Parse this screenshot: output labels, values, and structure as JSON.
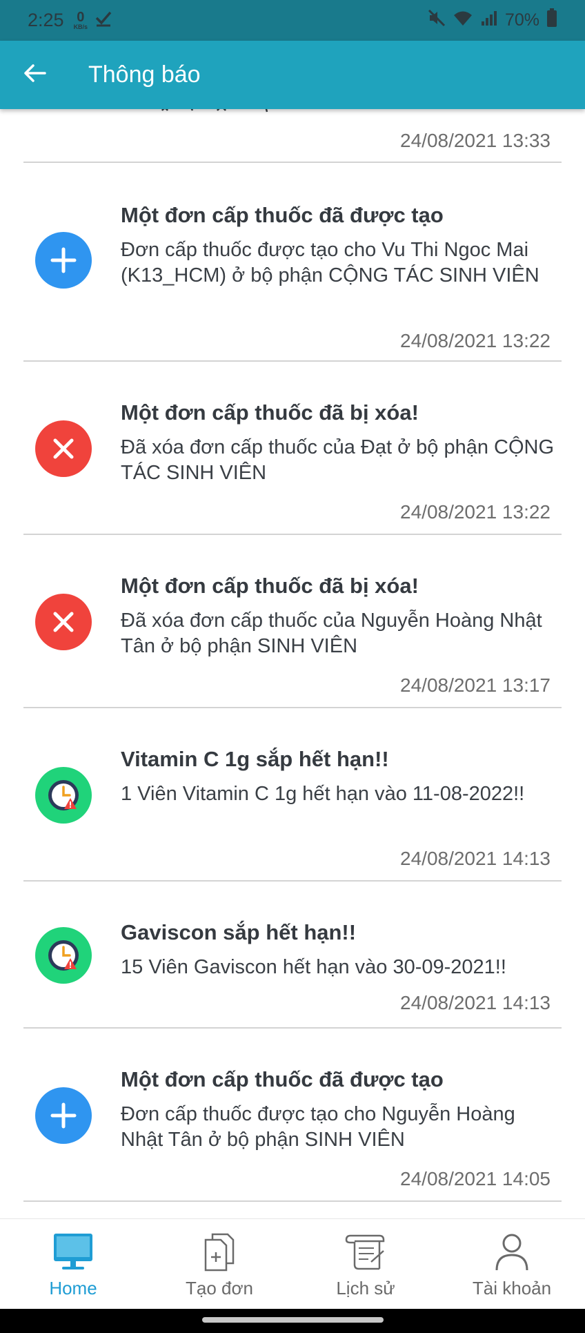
{
  "status_bar": {
    "time": "2:25",
    "speed_value": "0",
    "speed_unit": "KB/s",
    "battery": "70%"
  },
  "app_bar": {
    "title": "Thông báo"
  },
  "notifications": [
    {
      "type": "partial",
      "title": "",
      "body": "",
      "time": "24/08/2021 13:33"
    },
    {
      "type": "created",
      "icon": "plus-icon",
      "icon_color": "#2f95f0",
      "title": "Một đơn cấp thuốc đã được tạo",
      "body": "Đơn cấp thuốc được tạo cho Vu Thi Ngoc Mai (K13_HCM) ở bộ phận CỘNG TÁC SINH VIÊN",
      "time": "24/08/2021 13:22"
    },
    {
      "type": "deleted",
      "icon": "close-icon",
      "icon_color": "#f0433c",
      "title": "Một đơn cấp thuốc đã bị xóa!",
      "body": "Đã xóa đơn cấp thuốc của Đạt ở bộ phận CỘNG TÁC SINH VIÊN",
      "time": "24/08/2021 13:22"
    },
    {
      "type": "deleted",
      "icon": "close-icon",
      "icon_color": "#f0433c",
      "title": "Một đơn cấp thuốc đã bị xóa!",
      "body": "Đã xóa đơn cấp thuốc của Nguyễn Hoàng Nhật Tân ở bộ phận SINH VIÊN",
      "time": "24/08/2021 13:17"
    },
    {
      "type": "expiry",
      "icon": "clock-warning-icon",
      "icon_color": "#20d37a",
      "title": "Vitamin C 1g sắp hết hạn!!",
      "body": "1 Viên Vitamin C 1g hết hạn vào 11-08-2022!!",
      "time": "24/08/2021 14:13"
    },
    {
      "type": "expiry",
      "icon": "clock-warning-icon",
      "icon_color": "#20d37a",
      "title": "Gaviscon sắp hết hạn!!",
      "body": "15 Viên Gaviscon hết hạn vào 30-09-2021!!",
      "time": "24/08/2021 14:13"
    },
    {
      "type": "created",
      "icon": "plus-icon",
      "icon_color": "#2f95f0",
      "title": "Một đơn cấp thuốc đã được tạo",
      "body": "Đơn cấp thuốc được tạo cho Nguyễn Hoàng Nhật Tân ở bộ phận SINH VIÊN",
      "time": "24/08/2021 14:05"
    }
  ],
  "bottom_nav": [
    {
      "label": "Home",
      "icon": "monitor-icon",
      "active": true
    },
    {
      "label": "Tạo đơn",
      "icon": "new-document-icon",
      "active": false
    },
    {
      "label": "Lịch sử",
      "icon": "scroll-icon",
      "active": false
    },
    {
      "label": "Tài khoản",
      "icon": "user-icon",
      "active": false
    }
  ],
  "colors": {
    "status_bar": "#197a8c",
    "app_bar": "#1fa3bd",
    "active_nav": "#1f9dd4"
  }
}
